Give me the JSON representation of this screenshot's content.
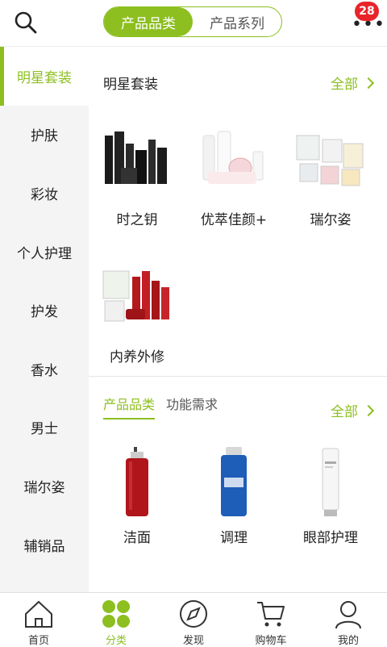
{
  "header": {
    "tabs": [
      {
        "label": "产品品类",
        "active": true
      },
      {
        "label": "产品系列",
        "active": false
      }
    ],
    "badge_count": "28",
    "search_icon": "search-icon",
    "more_icon": "more-dots-icon"
  },
  "sidebar": {
    "items": [
      {
        "label": "明星套装",
        "active": true
      },
      {
        "label": "护肤"
      },
      {
        "label": "彩妆"
      },
      {
        "label": "个人护理"
      },
      {
        "label": "护发"
      },
      {
        "label": "香水"
      },
      {
        "label": "男士"
      },
      {
        "label": "瑞尔姿"
      },
      {
        "label": "辅销品"
      }
    ]
  },
  "main": {
    "star_section": {
      "title": "明星套装",
      "all_label": "全部",
      "items": [
        {
          "label": "时之钥"
        },
        {
          "label": "优萃佳颜+"
        },
        {
          "label": "瑞尔姿"
        },
        {
          "label": "内养外修"
        }
      ]
    },
    "category_section": {
      "tabs": [
        {
          "label": "产品品类",
          "active": true
        },
        {
          "label": "功能需求",
          "active": false
        }
      ],
      "all_label": "全部",
      "items": [
        {
          "label": "洁面"
        },
        {
          "label": "调理"
        },
        {
          "label": "眼部护理"
        }
      ]
    }
  },
  "bottom_nav": {
    "items": [
      {
        "label": "首页",
        "icon": "home-icon"
      },
      {
        "label": "分类",
        "icon": "category-icon",
        "active": true
      },
      {
        "label": "发现",
        "icon": "discover-icon"
      },
      {
        "label": "购物车",
        "icon": "cart-icon"
      },
      {
        "label": "我的",
        "icon": "profile-icon"
      }
    ]
  },
  "colors": {
    "accent": "#8cbf1f",
    "badge": "#e8242a"
  }
}
